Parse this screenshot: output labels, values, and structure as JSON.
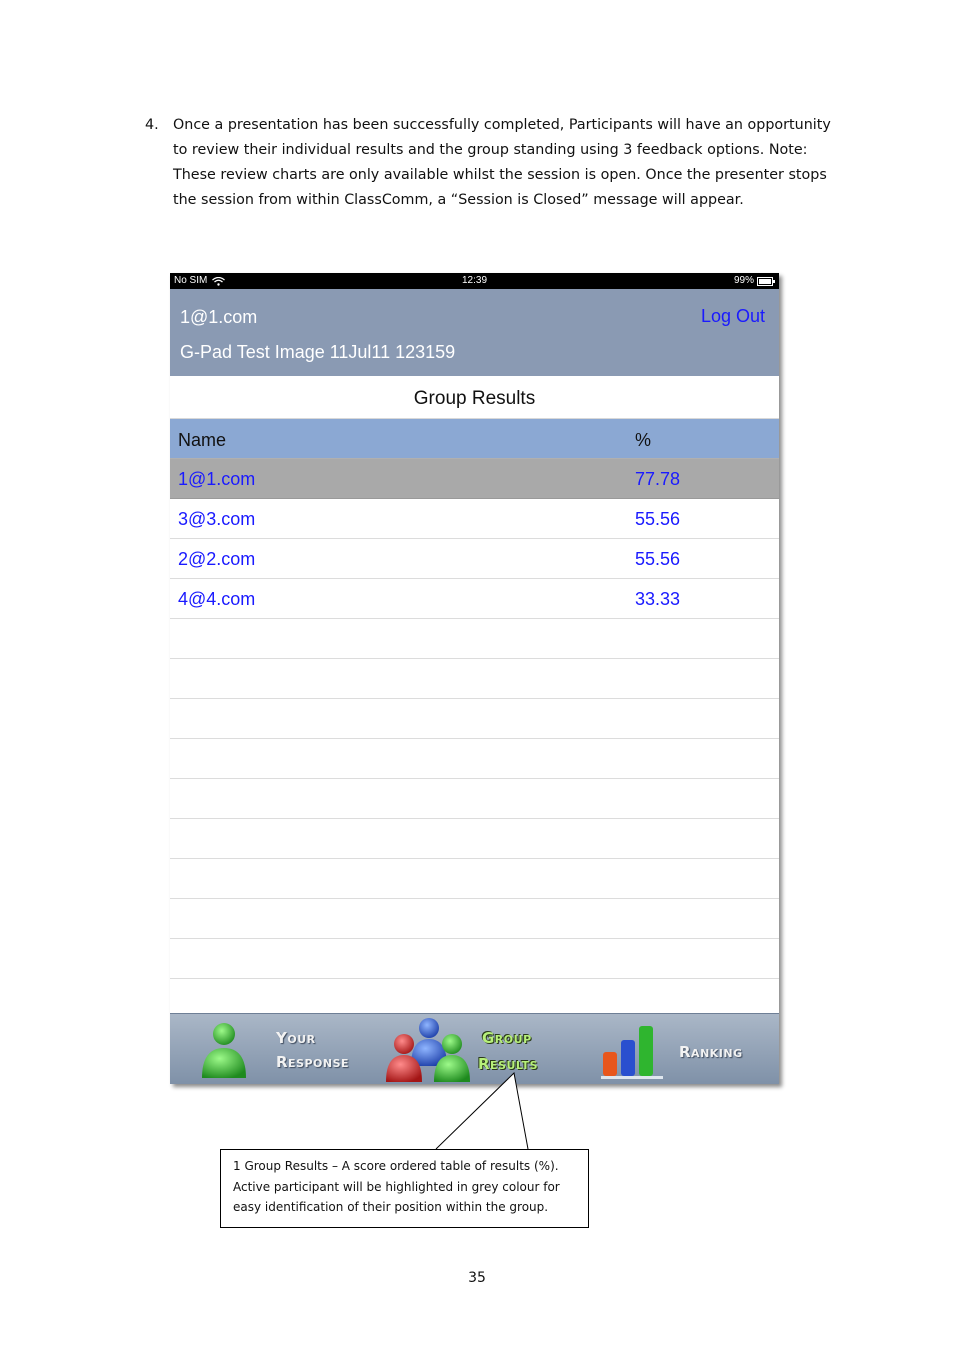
{
  "doc": {
    "step_number": "4.",
    "paragraph": "Once a presentation has been successfully completed, Participants will have an opportunity to review their individual results and the group standing using 3 feedback options.  Note: These review charts are only available whilst the session is open.  Once the presenter stops the session from within ClassComm, a “Session is Closed” message will appear.",
    "caption": "1  Group Results – A score ordered table of results (%). Active participant will be highlighted in grey colour for easy identification of their position within the group.",
    "page_number": "35"
  },
  "statusbar": {
    "carrier": "No SIM",
    "time": "12:39",
    "battery": "99%"
  },
  "header": {
    "user": "1@1.com",
    "session": "G-Pad Test Image 11Jul11 123159",
    "logout_label": "Log Out"
  },
  "table": {
    "title": "Group Results",
    "columns": [
      "Name",
      "%"
    ],
    "rows": [
      {
        "name": "1@1.com",
        "pct": "77.78",
        "active": true
      },
      {
        "name": "3@3.com",
        "pct": "55.56",
        "active": false
      },
      {
        "name": "2@2.com",
        "pct": "55.56",
        "active": false
      },
      {
        "name": "4@4.com",
        "pct": "33.33",
        "active": false
      }
    ]
  },
  "tabs": [
    {
      "line1": "Your",
      "line2": "Response",
      "icon": "person-icon"
    },
    {
      "line1": "Group",
      "line2": "Results",
      "icon": "group-icon"
    },
    {
      "line1": "Ranking",
      "icon": "bar-chart-icon"
    }
  ],
  "colors": {
    "header_bg": "#8a9ab3",
    "column_header_bg": "#8ba8d3",
    "active_row_bg": "#a9a9a9",
    "link_blue": "#1a1aff",
    "selected_tab_label": "#b7f07a"
  }
}
